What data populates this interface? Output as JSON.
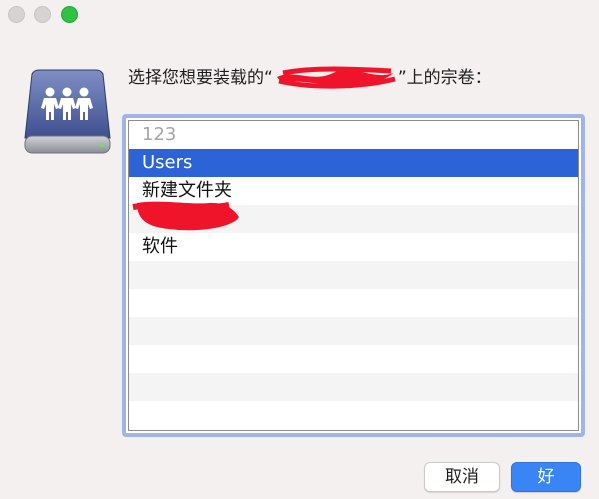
{
  "window": {
    "traffic_lights": [
      "close",
      "minimize",
      "zoom"
    ],
    "colors": {
      "zoom": "#2fc243",
      "inactive": "#d6d3d2"
    }
  },
  "icon": {
    "name": "shared-server-drive-icon"
  },
  "prompt": {
    "before": "选择您想要装载的“",
    "after": "”上的宗卷："
  },
  "list": {
    "items": [
      {
        "label": "123",
        "state": "disabled"
      },
      {
        "label": "Users",
        "state": "selected"
      },
      {
        "label": "新建文件夹",
        "state": "normal"
      },
      {
        "label": "",
        "state": "redacted"
      },
      {
        "label": "软件",
        "state": "normal"
      }
    ],
    "selection_color": "#2c63d6"
  },
  "buttons": {
    "cancel": "取消",
    "ok": "好"
  }
}
